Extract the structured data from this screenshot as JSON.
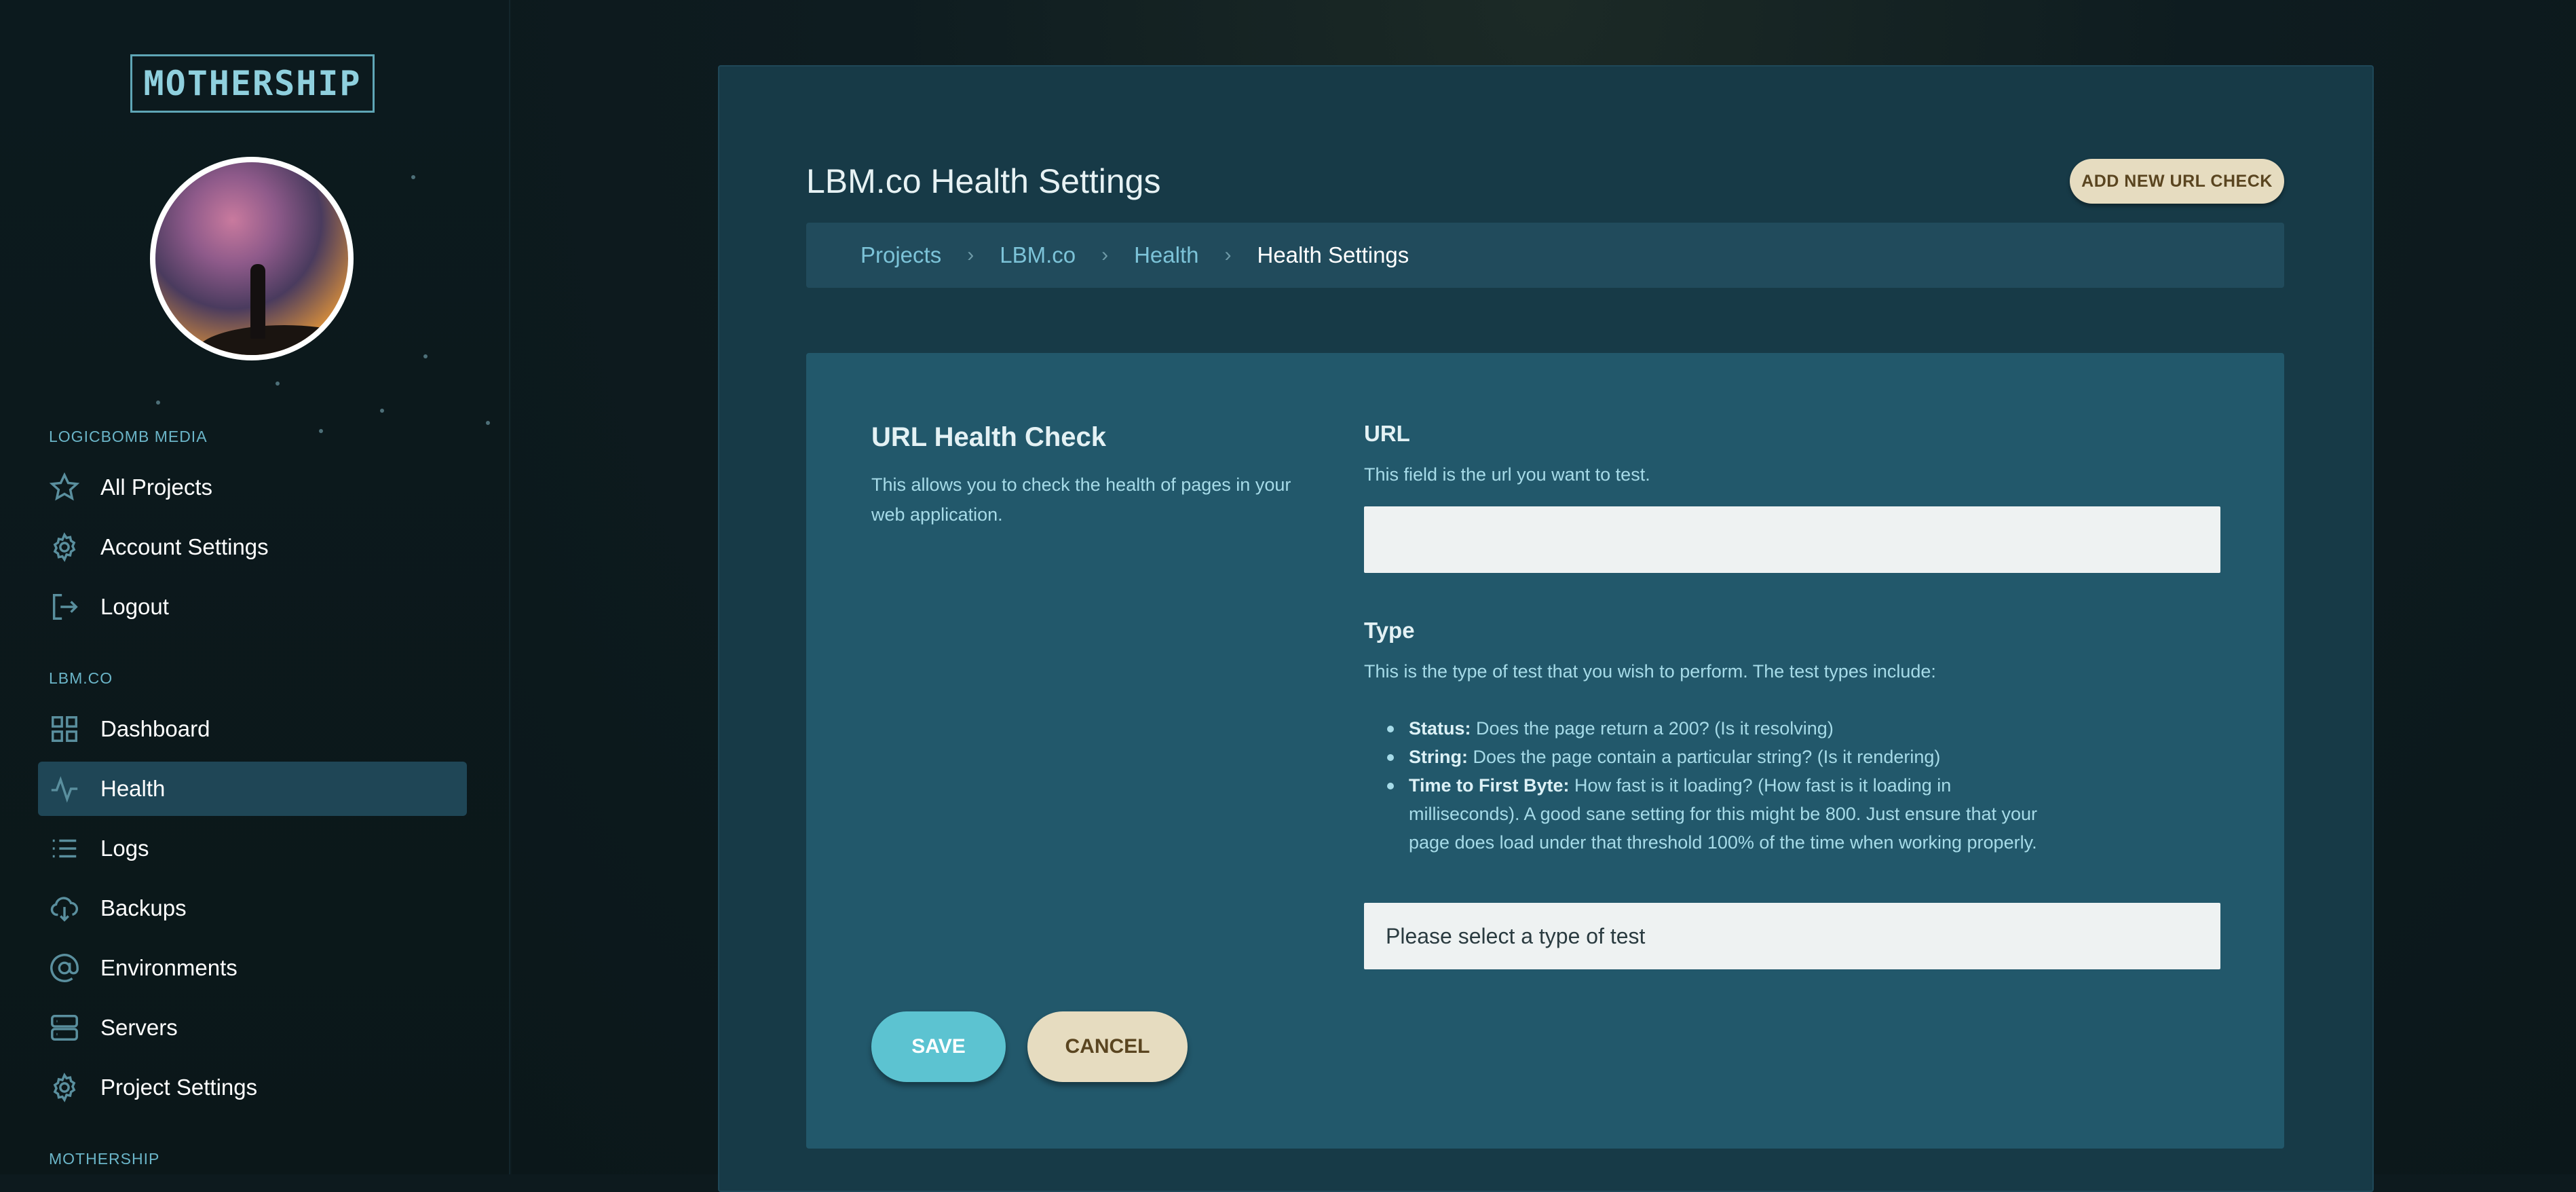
{
  "sidebar": {
    "logo": "MOTHERSHIP",
    "sections": [
      {
        "label": "LOGICBOMB MEDIA",
        "items": [
          {
            "label": "All Projects",
            "icon": "star-icon"
          },
          {
            "label": "Account Settings",
            "icon": "gear-icon"
          },
          {
            "label": "Logout",
            "icon": "logout-icon"
          }
        ]
      },
      {
        "label": "LBM.CO",
        "items": [
          {
            "label": "Dashboard",
            "icon": "grid-icon"
          },
          {
            "label": "Health",
            "icon": "pulse-icon",
            "active": true
          },
          {
            "label": "Logs",
            "icon": "list-icon"
          },
          {
            "label": "Backups",
            "icon": "cloud-download-icon"
          },
          {
            "label": "Environments",
            "icon": "at-icon"
          },
          {
            "label": "Servers",
            "icon": "server-icon"
          },
          {
            "label": "Project Settings",
            "icon": "gear-icon"
          }
        ]
      },
      {
        "label": "MOTHERSHIP",
        "items": []
      }
    ]
  },
  "header": {
    "title": "LBM.co Health Settings",
    "add_button": "ADD NEW URL CHECK"
  },
  "breadcrumb": [
    "Projects",
    "LBM.co",
    "Health",
    "Health Settings"
  ],
  "form": {
    "title": "URL Health Check",
    "description": "This allows you to check the health of pages in your web application.",
    "url": {
      "label": "URL",
      "help": "This field is the url you want to test.",
      "value": ""
    },
    "type": {
      "label": "Type",
      "help": "This is the type of test that you wish to perform. The test types include:",
      "options_help": [
        {
          "name": "Status:",
          "text": " Does the page return a 200? (Is it resolving)"
        },
        {
          "name": "String:",
          "text": " Does the page contain a particular string? (Is it rendering)"
        },
        {
          "name": "Time to First Byte:",
          "text": " How fast is it loading? (How fast is it loading in milliseconds). A good sane setting for this might be 800. Just ensure that your page does load under that threshold 100% of the time when working properly."
        }
      ],
      "selected": "Please select a type of test"
    },
    "save_label": "SAVE",
    "cancel_label": "CANCEL"
  },
  "colors": {
    "accent": "#5cc3d1",
    "secondary_button": "#e6dcc0",
    "card_bg": "#22586b",
    "active_nav": "#1f4656"
  }
}
